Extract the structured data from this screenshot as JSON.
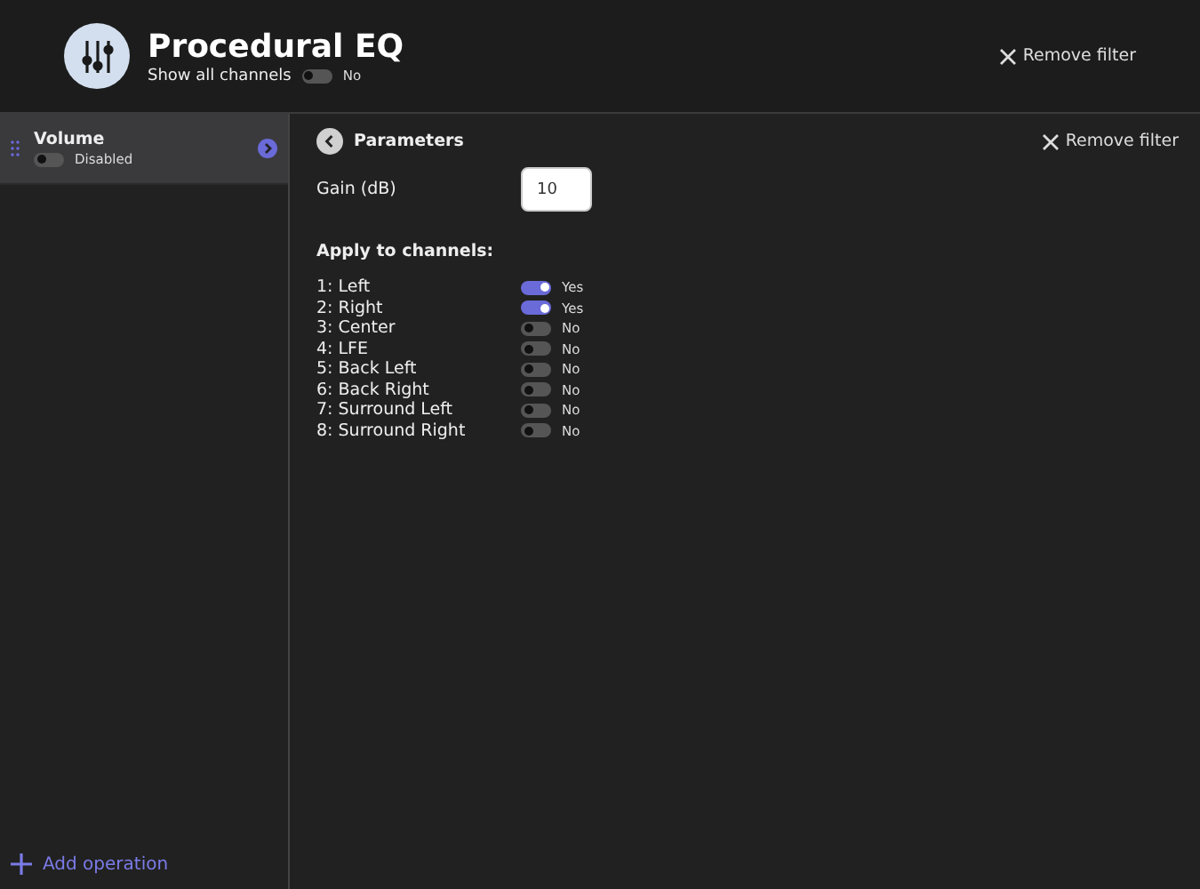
{
  "header": {
    "title": "Procedural EQ",
    "show_all_channels": {
      "label": "Show all channels",
      "on": false,
      "state_text": "No"
    },
    "remove_button": "Remove filter"
  },
  "sidebar": {
    "items": [
      {
        "name": "Volume",
        "on": false,
        "state_text": "Disabled",
        "selected": true
      }
    ],
    "add_button": "Add operation"
  },
  "panel": {
    "back_title": "Parameters",
    "remove_button": "Remove filter",
    "gain": {
      "label": "Gain (dB)",
      "value": "10"
    },
    "channels_heading": "Apply to channels:",
    "channels": [
      {
        "name": "1: Left",
        "on": true,
        "state_text": "Yes"
      },
      {
        "name": "2: Right",
        "on": true,
        "state_text": "Yes"
      },
      {
        "name": "3: Center",
        "on": false,
        "state_text": "No"
      },
      {
        "name": "4: LFE",
        "on": false,
        "state_text": "No"
      },
      {
        "name": "5: Back Left",
        "on": false,
        "state_text": "No"
      },
      {
        "name": "6: Back Right",
        "on": false,
        "state_text": "No"
      },
      {
        "name": "7: Surround Left",
        "on": false,
        "state_text": "No"
      },
      {
        "name": "8: Surround Right",
        "on": false,
        "state_text": "No"
      }
    ]
  }
}
